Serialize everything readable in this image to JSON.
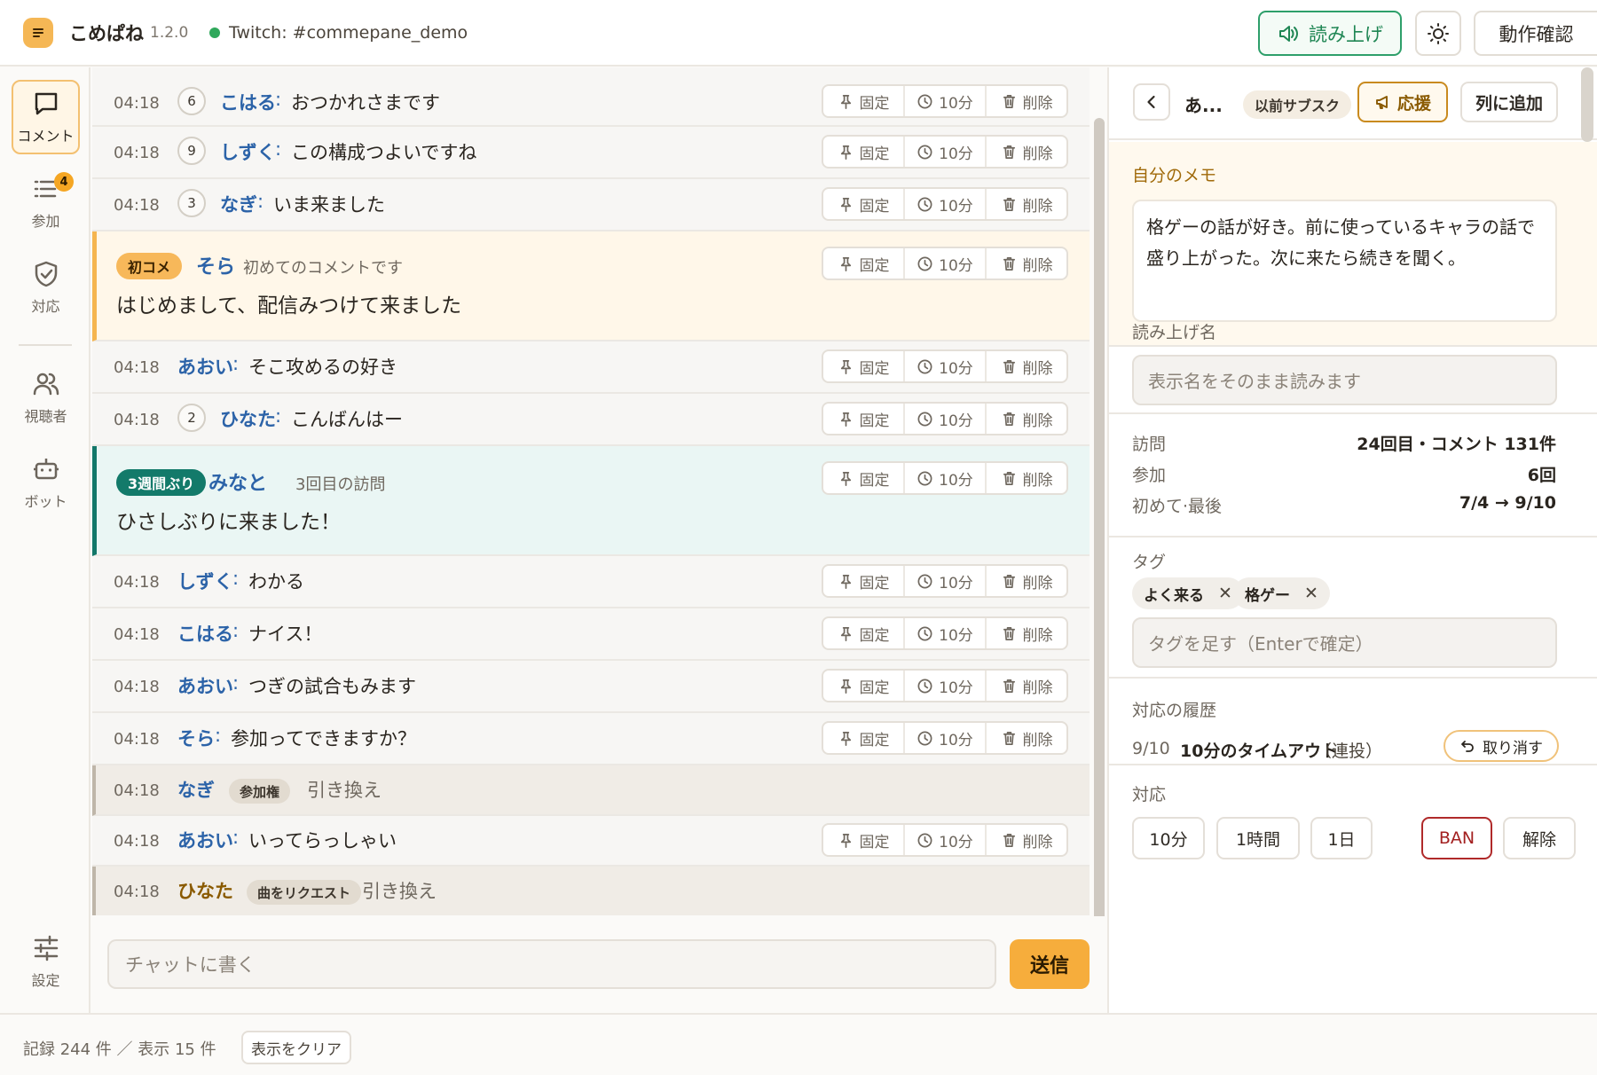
{
  "app": {
    "name": "こめぱね",
    "version": "1.2.0",
    "connection": "Twitch: #commepane_demo"
  },
  "header": {
    "read_aloud": "読み上げ",
    "check": "動作確認",
    "colors": {
      "accent": "#f5b755",
      "connected": "#2fa85b"
    }
  },
  "nav": {
    "comments": "コメント",
    "join": "参加",
    "join_badge": "4",
    "response": "対応",
    "viewers": "視聴者",
    "bot": "ボット",
    "settings": "設定"
  },
  "actions": {
    "pin": "固定",
    "timeout": "10分",
    "delete": "削除"
  },
  "comments": [
    {
      "time": "04:18",
      "count": "6",
      "name": "こはる",
      "message": "おつかれさまです"
    },
    {
      "time": "04:18",
      "count": "9",
      "name": "しずく",
      "message": "この構成つよいですね"
    },
    {
      "time": "04:18",
      "count": "3",
      "name": "なぎ",
      "message": "いま来ました"
    },
    {
      "badge": "初コメ",
      "name": "そら",
      "sub": "初めてのコメントです",
      "message": "はじめまして、配信みつけて来ました"
    },
    {
      "time": "04:18",
      "name": "あおい",
      "message": "そこ攻めるの好き"
    },
    {
      "time": "04:18",
      "count": "2",
      "name": "ひなた",
      "message": "こんばんはー"
    },
    {
      "badge": "3週間ぶり",
      "name": "みなと",
      "sub": "3回目の訪問",
      "message": "ひさしぶりに来ました！"
    },
    {
      "time": "04:18",
      "name": "しずく",
      "message": "わかる"
    },
    {
      "time": "04:18",
      "name": "こはる",
      "message": "ナイス！"
    },
    {
      "time": "04:18",
      "name": "あおい",
      "message": "つぎの試合もみます"
    },
    {
      "time": "04:18",
      "name": "そら",
      "message": "参加ってできますか？"
    },
    {
      "time": "04:18",
      "name": "なぎ",
      "reward": "参加権",
      "redeem_text": "引き換え"
    },
    {
      "time": "04:18",
      "name": "あおい",
      "message": "いってらっしゃい"
    },
    {
      "time": "04:18",
      "name": "ひなた",
      "reward": "曲をリクエスト",
      "redeem_text": "引き換え"
    }
  ],
  "colon": ":",
  "composer": {
    "placeholder": "チャットに書く",
    "send": "送信"
  },
  "panel": {
    "name": "あ...",
    "tag": "以前サブスク",
    "support": "応援",
    "queue": "列に追加",
    "memo_label": "自分のメモ",
    "memo": "格ゲーの話が好き。前に使っているキャラの話で盛り上がった。次に来たら続きを聞く。",
    "read_name_label": "読み上げ名",
    "read_name_placeholder": "表示名をそのまま読みます",
    "stats": [
      {
        "label": "訪問",
        "value": "24回目・コメント 131件"
      },
      {
        "label": "参加",
        "value": "6回"
      },
      {
        "label": "初めて·最後",
        "value": "7/4 → 9/10"
      }
    ],
    "tags_label": "タグ",
    "tags": [
      "よく来る",
      "格ゲー"
    ],
    "tag_placeholder": "タグを足す（Enterで確定）",
    "history_label": "対応の履歴",
    "history": {
      "date": "9/10",
      "action": "10分のタイムアウト",
      "reason": "（連投）",
      "undo": "取り消す"
    },
    "moderation_label": "対応",
    "moderation": {
      "t10m": "10分",
      "t1h": "1時間",
      "t1d": "1日",
      "ban": "BAN",
      "unban": "解除"
    }
  },
  "footer": {
    "stats": "記録 244 件 ／ 表示 15 件",
    "clear": "表示をクリア"
  }
}
